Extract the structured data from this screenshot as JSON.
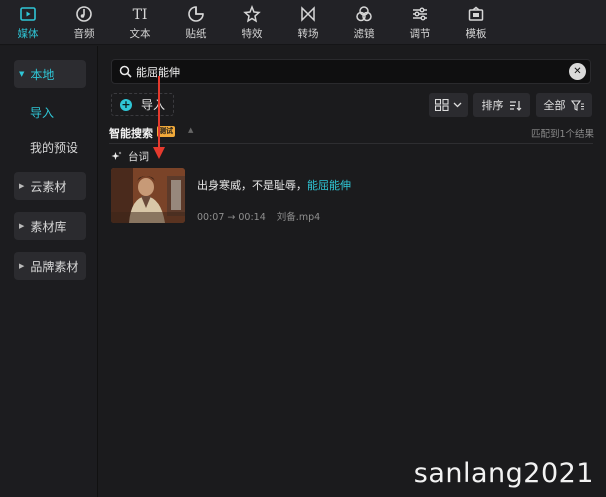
{
  "toolbar": {
    "items": [
      {
        "label": "媒体",
        "icon": "media-icon"
      },
      {
        "label": "音频",
        "icon": "audio-icon"
      },
      {
        "label": "文本",
        "icon": "text-icon"
      },
      {
        "label": "贴纸",
        "icon": "sticker-icon"
      },
      {
        "label": "特效",
        "icon": "effects-icon"
      },
      {
        "label": "转场",
        "icon": "transition-icon"
      },
      {
        "label": "滤镜",
        "icon": "filter-icon"
      },
      {
        "label": "调节",
        "icon": "adjust-icon"
      },
      {
        "label": "模板",
        "icon": "template-icon"
      }
    ],
    "active_index": 0,
    "text_icon_glyph": "TI"
  },
  "sidebar": {
    "local": "本地",
    "import": "导入",
    "presets": "我的预设",
    "cloud": "云素材",
    "library": "素材库",
    "brand": "品牌素材"
  },
  "search": {
    "query": "能屈能伸"
  },
  "import_button": "导入",
  "controls": {
    "sort_label": "排序",
    "filter_label": "全部"
  },
  "smart_search": {
    "title": "智能搜索",
    "badge": "测试",
    "match_count": "匹配到1个结果"
  },
  "category": "台词",
  "results": [
    {
      "text_before": "出身寒威，不是耻辱，",
      "highlight": "能屈能伸",
      "time_range": "00:07 → 00:14",
      "file": "刘备.mp4"
    }
  ],
  "watermark": "sanlang2021",
  "colors": {
    "accent": "#2fc6d6",
    "annotation_arrow": "#e53a2e"
  }
}
